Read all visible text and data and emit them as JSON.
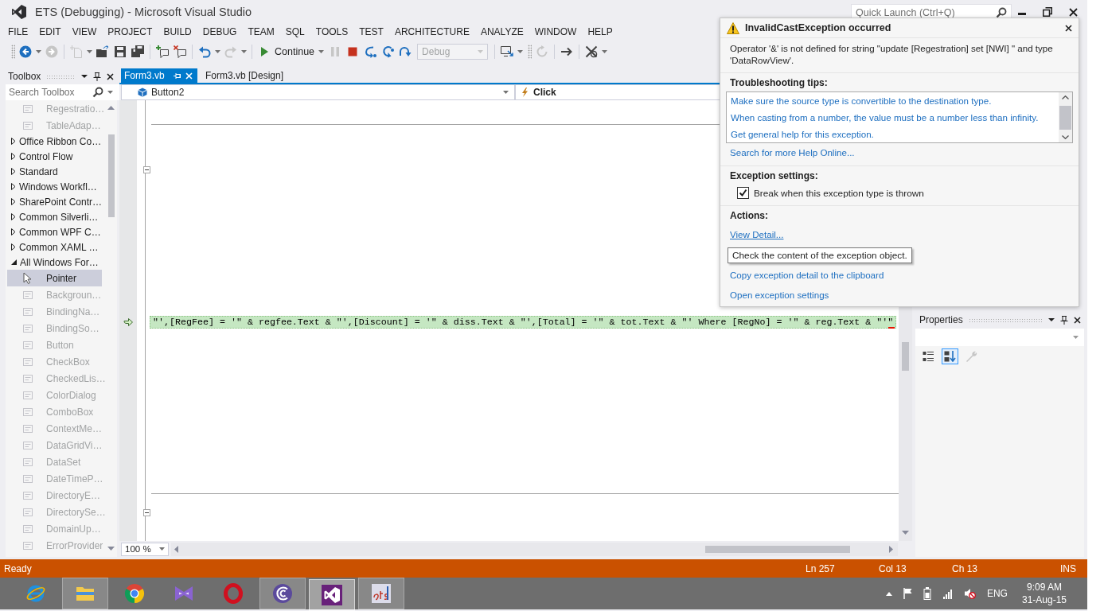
{
  "window": {
    "title": "ETS (Debugging) - Microsoft Visual Studio",
    "quick_launch": {
      "placeholder": "Quick Launch (Ctrl+Q)"
    }
  },
  "menu": [
    "FILE",
    "EDIT",
    "VIEW",
    "PROJECT",
    "BUILD",
    "DEBUG",
    "TEAM",
    "SQL",
    "TOOLS",
    "TEST",
    "ARCHITECTURE",
    "ANALYZE",
    "WINDOW",
    "HELP"
  ],
  "toolbar": [
    {
      "kind": "grip"
    },
    {
      "kind": "back",
      "disabled": false,
      "dropdown": true
    },
    {
      "kind": "forward",
      "disabled": true
    },
    {
      "kind": "separator"
    },
    {
      "kind": "newitem",
      "disabled": true,
      "dropdown": true
    },
    {
      "kind": "open",
      "disabled": false
    },
    {
      "kind": "save",
      "disabled": false
    },
    {
      "kind": "saveall",
      "disabled": false
    },
    {
      "kind": "separator"
    },
    {
      "kind": "bubbleadd",
      "disabled": false
    },
    {
      "kind": "bubbleremove",
      "disabled": false
    },
    {
      "kind": "separator"
    },
    {
      "kind": "undo",
      "disabled": false,
      "dropdown": true
    },
    {
      "kind": "redo",
      "disabled": true,
      "dropdown": true
    },
    {
      "kind": "separator"
    },
    {
      "kind": "continue",
      "label": "Continue",
      "disabled": false,
      "dropdown": true
    },
    {
      "kind": "pause",
      "disabled": true
    },
    {
      "kind": "stop",
      "disabled": false
    },
    {
      "kind": "shownext",
      "disabled": false
    },
    {
      "kind": "stepinto",
      "disabled": false
    },
    {
      "kind": "stepover",
      "disabled": false
    },
    {
      "kind": "combo",
      "value": "Debug",
      "disabled": true
    },
    {
      "kind": "separator"
    },
    {
      "kind": "device",
      "disabled": false,
      "dropdown": true
    },
    {
      "kind": "grip"
    },
    {
      "kind": "refresh",
      "disabled": true
    },
    {
      "kind": "separator"
    },
    {
      "kind": "arrow",
      "disabled": false
    },
    {
      "kind": "separator"
    },
    {
      "kind": "tools",
      "disabled": false,
      "dropdown": true
    }
  ],
  "toolbox": {
    "title": "Toolbox",
    "search": {
      "placeholder": "Search Toolbox"
    },
    "items": [
      {
        "kind": "item",
        "label": "Regestratio…",
        "disabled": true,
        "selected": false
      },
      {
        "kind": "item",
        "label": "TableAdap…",
        "disabled": true,
        "selected": false
      },
      {
        "kind": "group",
        "label": "Office Ribbon Co…",
        "expanded": false
      },
      {
        "kind": "group",
        "label": "Control Flow",
        "expanded": false
      },
      {
        "kind": "group",
        "label": "Standard",
        "expanded": false
      },
      {
        "kind": "group",
        "label": "Windows Workfl…",
        "expanded": false
      },
      {
        "kind": "group",
        "label": "SharePoint Contr…",
        "expanded": false
      },
      {
        "kind": "group",
        "label": "Common Silverli…",
        "expanded": false
      },
      {
        "kind": "group",
        "label": "Common WPF C…",
        "expanded": false
      },
      {
        "kind": "group",
        "label": "Common XAML …",
        "expanded": false
      },
      {
        "kind": "group",
        "label": "All Windows For…",
        "expanded": true,
        "children": [
          {
            "kind": "pointer",
            "label": "Pointer",
            "disabled": false,
            "selected": true
          },
          {
            "kind": "item",
            "label": "Backgroun…",
            "disabled": true,
            "selected": false
          },
          {
            "kind": "item",
            "label": "BindingNa…",
            "disabled": true,
            "selected": false
          },
          {
            "kind": "item",
            "label": "BindingSo…",
            "disabled": true,
            "selected": false
          },
          {
            "kind": "item",
            "label": "Button",
            "disabled": true,
            "selected": false
          },
          {
            "kind": "item",
            "label": "CheckBox",
            "disabled": true,
            "selected": false
          },
          {
            "kind": "item",
            "label": "CheckedLis…",
            "disabled": true,
            "selected": false
          },
          {
            "kind": "item",
            "label": "ColorDialog",
            "disabled": true,
            "selected": false
          },
          {
            "kind": "item",
            "label": "ComboBox",
            "disabled": true,
            "selected": false
          },
          {
            "kind": "item",
            "label": "ContextMe…",
            "disabled": true,
            "selected": false
          },
          {
            "kind": "item",
            "label": "DataGridVi…",
            "disabled": true,
            "selected": false
          },
          {
            "kind": "item",
            "label": "DataSet",
            "disabled": true,
            "selected": false
          },
          {
            "kind": "item",
            "label": "DateTimeP…",
            "disabled": true,
            "selected": false
          },
          {
            "kind": "item",
            "label": "DirectoryE…",
            "disabled": true,
            "selected": false
          },
          {
            "kind": "item",
            "label": "DirectorySe…",
            "disabled": true,
            "selected": false
          },
          {
            "kind": "item",
            "label": "DomainUp…",
            "disabled": true,
            "selected": false
          },
          {
            "kind": "item",
            "label": "ErrorProvider",
            "disabled": true,
            "selected": false
          }
        ]
      }
    ]
  },
  "editor": {
    "tabs": [
      {
        "label": "Form3.vb",
        "selected": true
      },
      {
        "label": "Form3.vb [Design]",
        "selected": false
      }
    ],
    "navigation": {
      "type": "Button2",
      "member": "Click"
    },
    "lines": [
      {
        "text": "\"',[RegFee] = '\" & regfee.Text & \"',[Discount] = '\" & diss.Text & \"',[Total] = '\" & tot.Text & \"' Where [RegNo] = '\" & reg.Text & \"'\"",
        "current": true
      }
    ],
    "zoom": "100 %"
  },
  "properties": {
    "title": "Properties",
    "tools": [
      {
        "kind": "categorized",
        "selected": false,
        "disabled": false
      },
      {
        "kind": "alphabetical",
        "selected": true,
        "disabled": false
      },
      {
        "kind": "pages",
        "selected": false,
        "disabled": true
      }
    ]
  },
  "exception": {
    "title": "InvalidCastException occurred",
    "message": "Operator '&' is not defined for string \"update [Regestration] set [NWI] \" and type 'DataRowView'.",
    "tips_heading": "Troubleshooting tips:",
    "tips": [
      "Make sure the source type is convertible to the destination type.",
      "When casting from a number, the value must be a number less than infinity.",
      "Get general help for this exception."
    ],
    "help_link": "Search for more Help Online...",
    "settings_heading": "Exception settings:",
    "break_setting": {
      "label": "Break when this exception type is thrown",
      "checked": true
    },
    "actions_heading": "Actions:",
    "actions": [
      {
        "label": "View Detail...",
        "hovered": true
      },
      {
        "label": "Copy exception detail to the clipboard",
        "hovered": false
      },
      {
        "label": "Open exception settings",
        "hovered": false
      }
    ],
    "tooltip": "Check the content of the exception object."
  },
  "status_bar": {
    "message": "Ready",
    "line": "Ln 257",
    "column": "Col 13",
    "char": "Ch 13",
    "mode": "INS"
  },
  "taskbar": {
    "apps": [
      {
        "kind": "globe",
        "running": false,
        "active": false
      },
      {
        "kind": "folder",
        "running": true,
        "active": false
      },
      {
        "kind": "wheel",
        "running": false,
        "active": false
      },
      {
        "kind": "bowtie",
        "running": false,
        "active": false
      },
      {
        "kind": "ring",
        "running": false,
        "active": false
      },
      {
        "kind": "crescent",
        "running": true,
        "active": false
      },
      {
        "kind": "ribbon",
        "running": true,
        "active": true
      },
      {
        "kind": "logo",
        "running": true,
        "active": false
      }
    ],
    "tray": {
      "muted": true,
      "language": "ENG",
      "time": "9:09 AM",
      "date": "31-Aug-15"
    }
  }
}
